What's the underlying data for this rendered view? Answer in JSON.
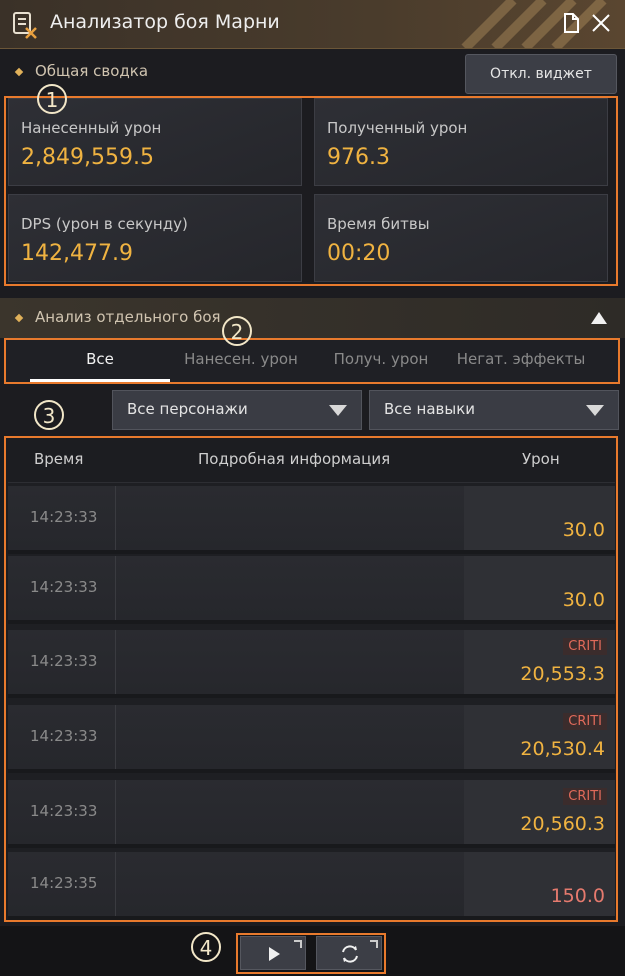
{
  "window": {
    "title": "Анализатор боя Марни"
  },
  "summary": {
    "section_label": "Общая сводка",
    "disable_widget_label": "Откл. виджет",
    "cards": [
      {
        "label": "Нанесенный урон",
        "value": "2,849,559.5"
      },
      {
        "label": "Полученный урон",
        "value": "976.3"
      },
      {
        "label": "DPS (урон в секунду)",
        "value": "142,477.9"
      },
      {
        "label": "Время битвы",
        "value": "00:20"
      }
    ]
  },
  "analysis": {
    "section_label": "Анализ отдельного боя",
    "tabs": [
      {
        "label": "Все",
        "active": true
      },
      {
        "label": "Нанесен. урон",
        "active": false
      },
      {
        "label": "Получ. урон",
        "active": false
      },
      {
        "label": "Негат. эффекты",
        "active": false
      }
    ],
    "filters": {
      "characters": "Все персонажи",
      "skills": "Все навыки"
    },
    "columns": {
      "time": "Время",
      "details": "Подробная информация",
      "damage": "Урон"
    },
    "rows": [
      {
        "time": "14:23:33",
        "crit": "",
        "damage": "30.0",
        "received": false
      },
      {
        "time": "14:23:33",
        "crit": "",
        "damage": "30.0",
        "received": false
      },
      {
        "time": "14:23:33",
        "crit": "CRITI",
        "damage": "20,553.3",
        "received": false
      },
      {
        "time": "14:23:33",
        "crit": "CRITI",
        "damage": "20,530.4",
        "received": false
      },
      {
        "time": "14:23:33",
        "crit": "CRITI",
        "damage": "20,560.3",
        "received": false
      },
      {
        "time": "14:23:35",
        "crit": "",
        "damage": "150.0",
        "received": true
      }
    ]
  },
  "annotations": [
    "1",
    "2",
    "3",
    "4"
  ],
  "colors": {
    "accent_gold": "#f0b341",
    "highlight_frame": "#e87a2d",
    "received_damage": "#e57a6e",
    "crit": "#e06a5a"
  },
  "icons": {
    "app": "combat-scroll-icon",
    "document": "document-icon",
    "close": "close-icon",
    "play": "play-icon",
    "refresh": "refresh-icon"
  }
}
